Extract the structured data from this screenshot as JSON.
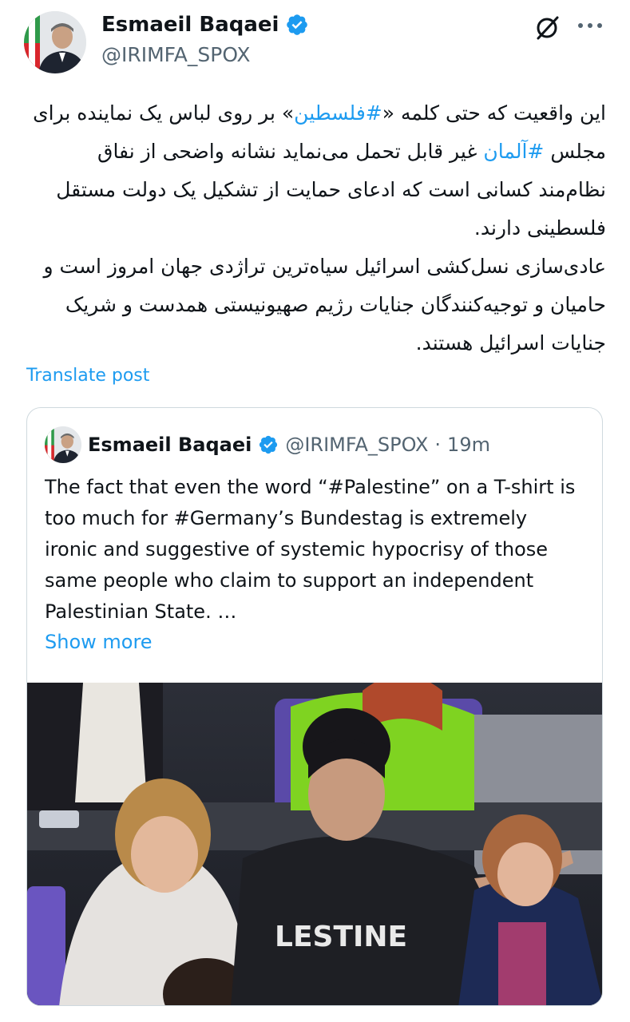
{
  "post": {
    "author_name": "Esmaeil Baqaei",
    "author_handle": "@IRIMFA_SPOX",
    "icons": {
      "verified": "verified-badge-icon",
      "grok": "grok-icon",
      "more": "more-options-icon"
    },
    "text_rtl": {
      "line1_before": "این واقعیت که حتی کلمه «",
      "hashtag1": "#فلسطین",
      "line1_after": "» بر روی لباس یک نماینده برای مجلس ",
      "hashtag2": "#آلمان",
      "line2_after": " غیر قابل تحمل می‌نماید نشانه واضحی از نفاق نظام‌مند کسانی است که ادعای حمایت از تشکیل یک دولت مستقل فلسطینی دارند.",
      "paragraph2": "عادی‌سازی نسل‌کشی اسرائیل سیاه‌ترین تراژدی جهان امروز است و حامیان و توجیه‌کنندگان جنایات رژیم صهیونیستی همدست و شریک جنایات اسرائیل هستند."
    },
    "translate_label": "Translate post"
  },
  "quote": {
    "author_name": "Esmaeil Baqaei",
    "author_handle": "@IRIMFA_SPOX",
    "separator": "·",
    "time": "19m",
    "text": "The fact that even the word “#Palestine” on a T-shirt is too much for #Germany’s Bundestag is extremely ironic and suggestive of systemic hypocrisy of those same people who claim to support an independent Palestinian State. …",
    "show_more": "Show more",
    "photo": {
      "shirt_text": "LESTINE"
    }
  },
  "colors": {
    "accent": "#1d9bf0",
    "text": "#0f1419",
    "secondary": "#536471",
    "border": "#cfd9de"
  }
}
